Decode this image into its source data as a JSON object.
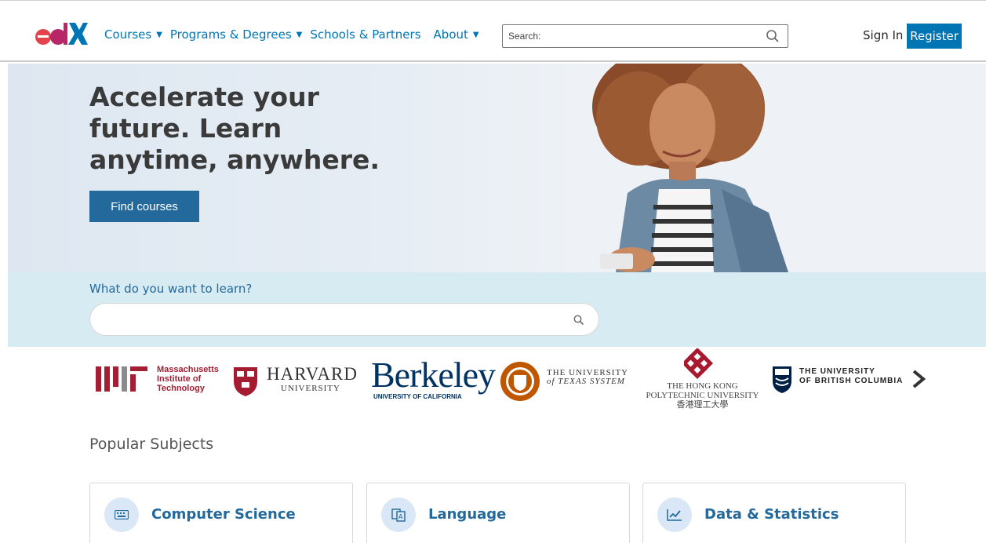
{
  "header": {
    "logo_text": "edX",
    "nav": [
      {
        "label": "Courses",
        "has_caret": true
      },
      {
        "label": "Programs & Degrees",
        "has_caret": true
      },
      {
        "label": "Schools & Partners",
        "has_caret": false
      },
      {
        "label": "About",
        "has_caret": true
      }
    ],
    "search_placeholder": "Search:",
    "sign_in": "Sign In",
    "register": "Register"
  },
  "hero": {
    "title": "Accelerate your future. Learn anytime, anywhere.",
    "cta": "Find courses"
  },
  "learn": {
    "label": "What do you want to learn?",
    "input_value": ""
  },
  "partners": {
    "mit": "Massachusetts Institute of Technology",
    "harvard": "HARVARD",
    "harvard_sub": "UNIVERSITY",
    "berkeley": "Berkeley",
    "berkeley_sub": "UNIVERSITY OF CALIFORNIA",
    "ut_line1": "THE UNIVERSITY",
    "ut_line2": "of TEXAS SYSTEM",
    "polyu_line1": "THE HONG KONG",
    "polyu_line2": "POLYTECHNIC UNIVERSITY",
    "polyu_line3": "香港理工大學",
    "ubc_line1": "THE UNIVERSITY",
    "ubc_line2": "OF BRITISH COLUMBIA"
  },
  "popular": {
    "heading": "Popular Subjects",
    "subjects": [
      {
        "label": "Computer Science",
        "icon": "keyboard-icon"
      },
      {
        "label": "Language",
        "icon": "translate-icon"
      },
      {
        "label": "Data & Statistics",
        "icon": "line-chart-icon"
      }
    ]
  },
  "colors": {
    "brand_blue": "#0075b4",
    "button_blue": "#23699c",
    "hero_bg": "#e6edf4",
    "learn_bg": "#d6ebf2",
    "mit_red": "#a31f34",
    "berkeley_blue": "#003262"
  }
}
